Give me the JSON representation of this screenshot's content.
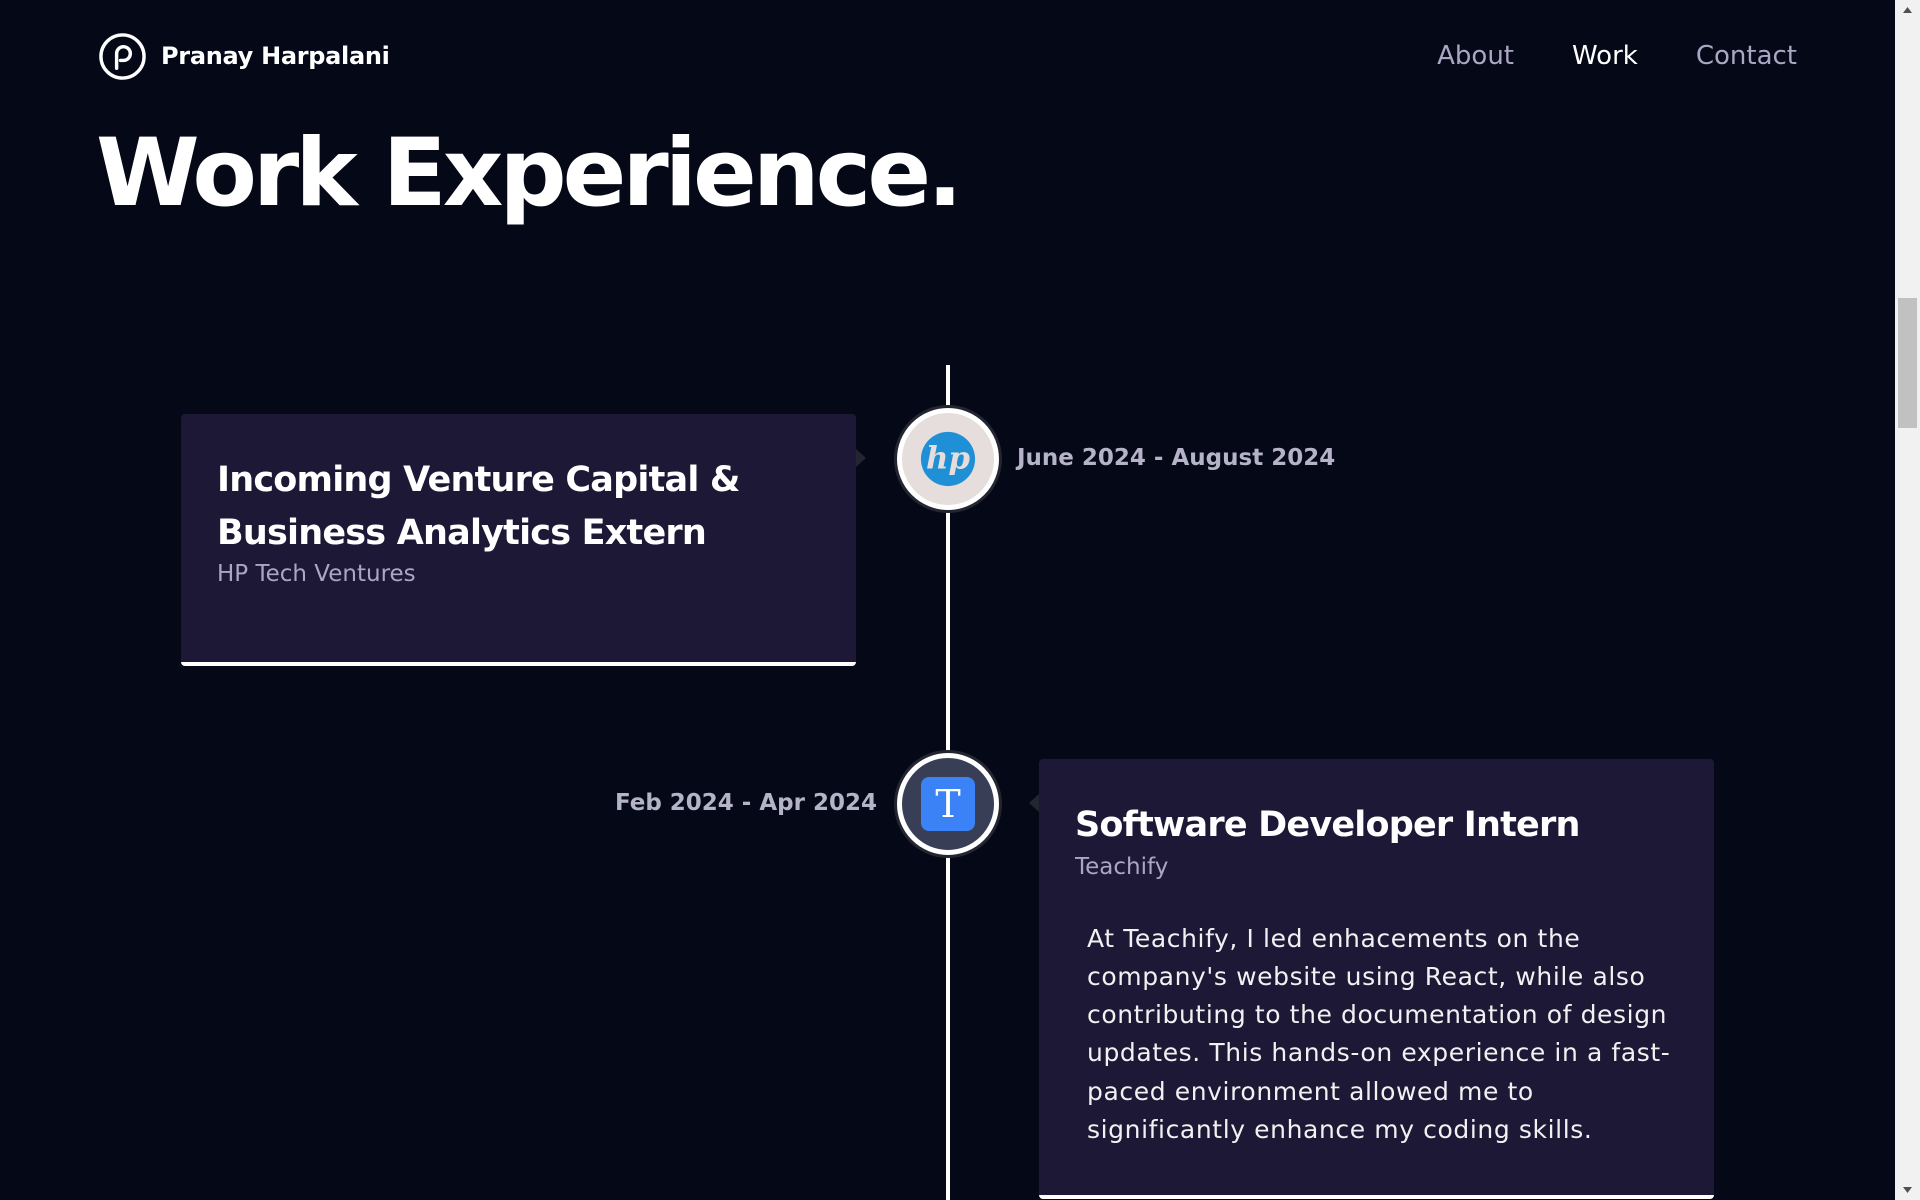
{
  "nav": {
    "brand_name": "Pranay Harpalani",
    "links": [
      {
        "label": "About",
        "active": false
      },
      {
        "label": "Work",
        "active": true
      },
      {
        "label": "Contact",
        "active": false
      }
    ]
  },
  "section": {
    "title": "Work Experience."
  },
  "experiences": [
    {
      "title": "Incoming Venture Capital & Business Analytics Extern",
      "company": "HP Tech Ventures",
      "date": "June 2024 - August 2024",
      "icon": "hp-logo-icon",
      "icon_bg": "#e6dedd",
      "description": ""
    },
    {
      "title": "Software Developer Intern",
      "company": "Teachify",
      "date": "Feb 2024 - Apr 2024",
      "icon": "teachify-logo-icon",
      "icon_bg": "#383e56",
      "description": "At Teachify, I led enhacements on the company's website using React, while also contributing to the documentation of design updates. This hands-on experience in a fast-paced environment allowed me to significantly enhance my coding skills."
    }
  ],
  "colors": {
    "background": "#050816",
    "card": "#1d1836",
    "secondary_text": "#aaa6c3",
    "hp_blue": "#1f8fd6",
    "teachify_blue": "#3b82f6"
  }
}
